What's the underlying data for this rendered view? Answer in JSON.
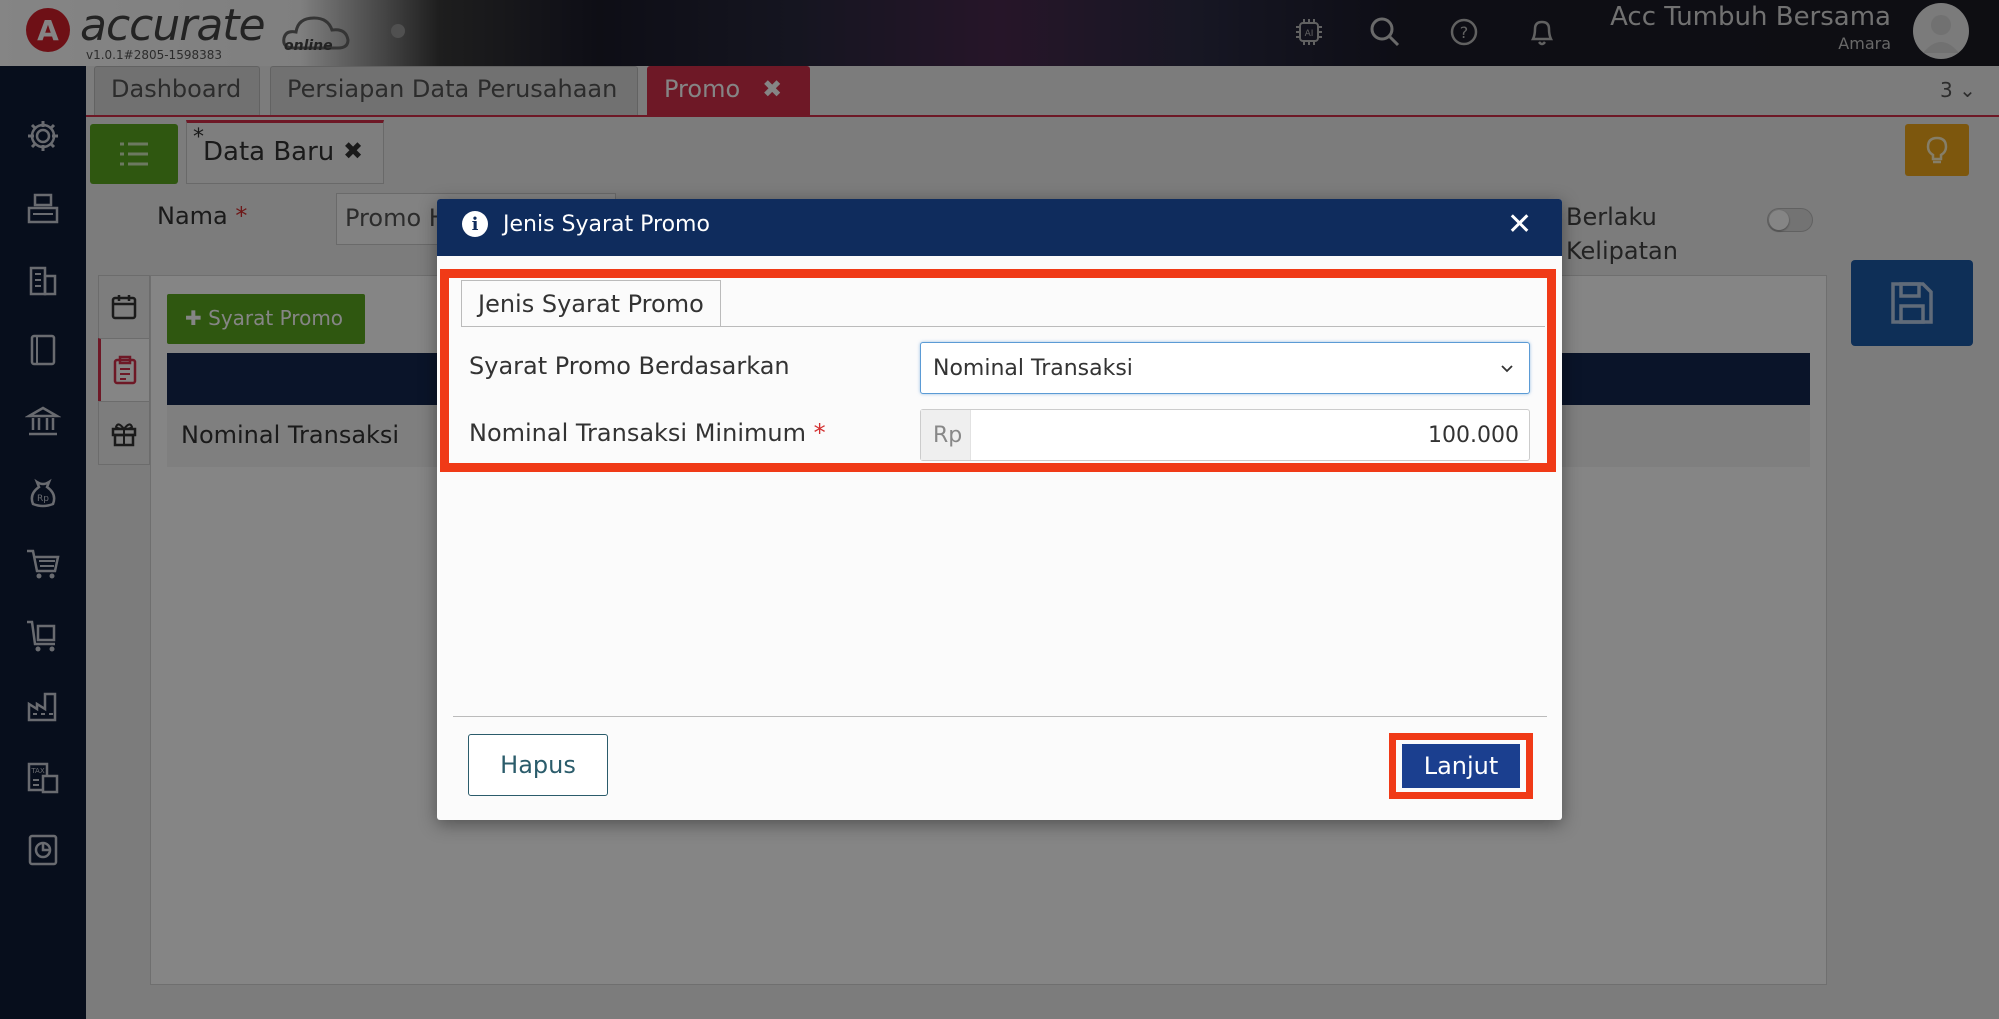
{
  "header": {
    "logo_letter": "A",
    "logo_text": "accurate",
    "logo_sub": "online",
    "version": "v1.0.1#2805-1598383",
    "company": "Acc Tumbuh Bersama",
    "user": "Amara",
    "icons": [
      "ai-chip-icon",
      "search-icon",
      "help-icon",
      "bell-icon"
    ]
  },
  "sidebar": {
    "items": [
      "gear-icon",
      "cash-register-icon",
      "building-icon",
      "book-icon",
      "bank-icon",
      "money-bag-icon",
      "cart-icon",
      "purchase-cart-icon",
      "factory-icon",
      "tax-icon",
      "report-icon"
    ]
  },
  "tabs": [
    {
      "label": "Dashboard"
    },
    {
      "label": "Persiapan Data Perusahaan"
    },
    {
      "label": "Promo",
      "close": "✖"
    }
  ],
  "tab_count": "3",
  "subtab": {
    "star": "*",
    "label": "Data Baru",
    "close": "✖"
  },
  "form": {
    "nama_label": "Nama",
    "nama_value": "Promo H",
    "berlaku_label": "Berlaku Kelipatan",
    "required_mark": "*"
  },
  "panel": {
    "add_button": "Syarat Promo",
    "row_value": "Nominal Transaksi"
  },
  "modal": {
    "title": "Jenis Syarat Promo",
    "tab_label": "Jenis Syarat Promo",
    "field1_label": "Syarat Promo Berdasarkan",
    "field1_value": "Nominal Transaksi",
    "field2_label": "Nominal Transaksi Minimum",
    "field2_required": "*",
    "field2_prefix": "Rp",
    "field2_value": "100.000",
    "btn_delete": "Hapus",
    "btn_next": "Lanjut"
  },
  "colors": {
    "header_navy": "#0f2c5d",
    "sidebar": "#0f1b36",
    "accent_red": "#d32f4a",
    "highlight": "#f03a17",
    "primary_blue": "#1b3f8f",
    "green": "#5aa820"
  }
}
